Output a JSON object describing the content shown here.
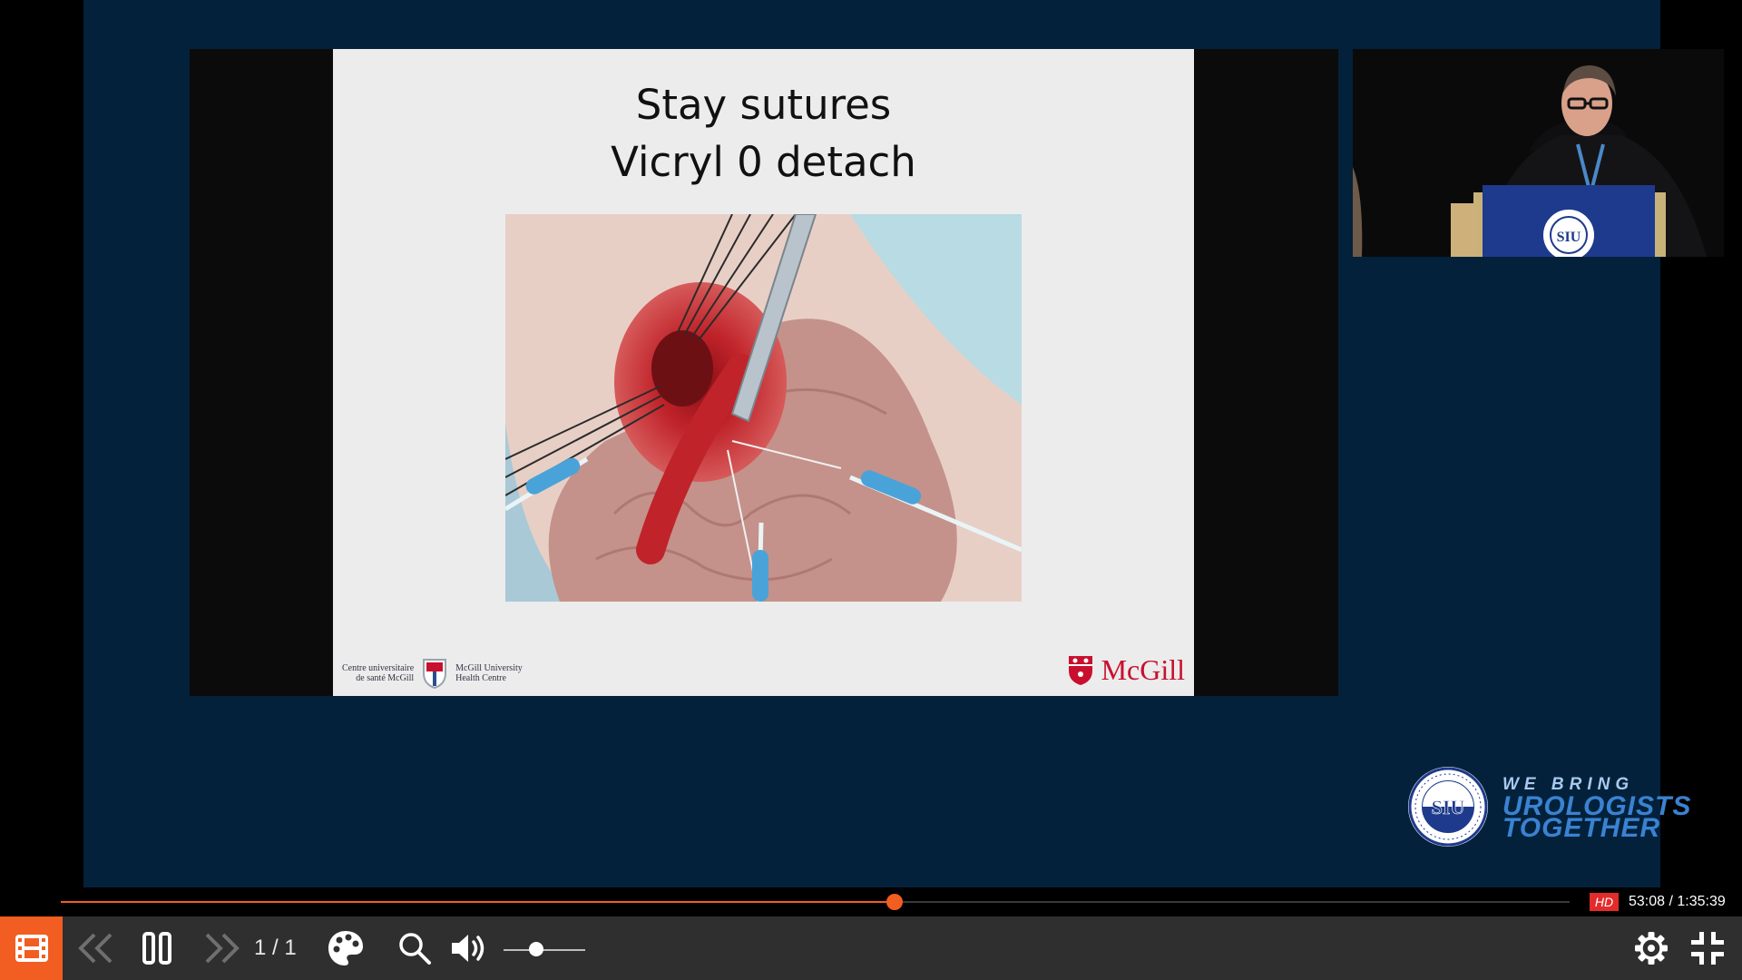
{
  "slide": {
    "title_line1": "Stay sutures",
    "title_line2": "Vicryl 0 detach",
    "footer_left_fr_line1": "Centre universitaire",
    "footer_left_fr_line2": "de santé McGill",
    "footer_left_en_line1": "McGill University",
    "footer_left_en_line2": "Health Centre",
    "footer_right": "McGill"
  },
  "branding": {
    "siu_seal_text": "SIU",
    "tagline_line1": "WE BRING",
    "tagline_line2": "UROLOGISTS",
    "tagline_line3": "TOGETHER"
  },
  "player": {
    "progress_fraction": 0.5526,
    "quality_badge": "HD",
    "time_display": "53:08 / 1:35:39",
    "page_indicator": "1 / 1",
    "volume_fraction": 0.4,
    "accent_color": "#f25d22",
    "icons": [
      "film-icon",
      "skip-back-icon",
      "pause-icon",
      "skip-forward-icon",
      "palette-icon",
      "search-icon",
      "volume-icon",
      "gear-icon",
      "exit-fullscreen-icon"
    ]
  }
}
